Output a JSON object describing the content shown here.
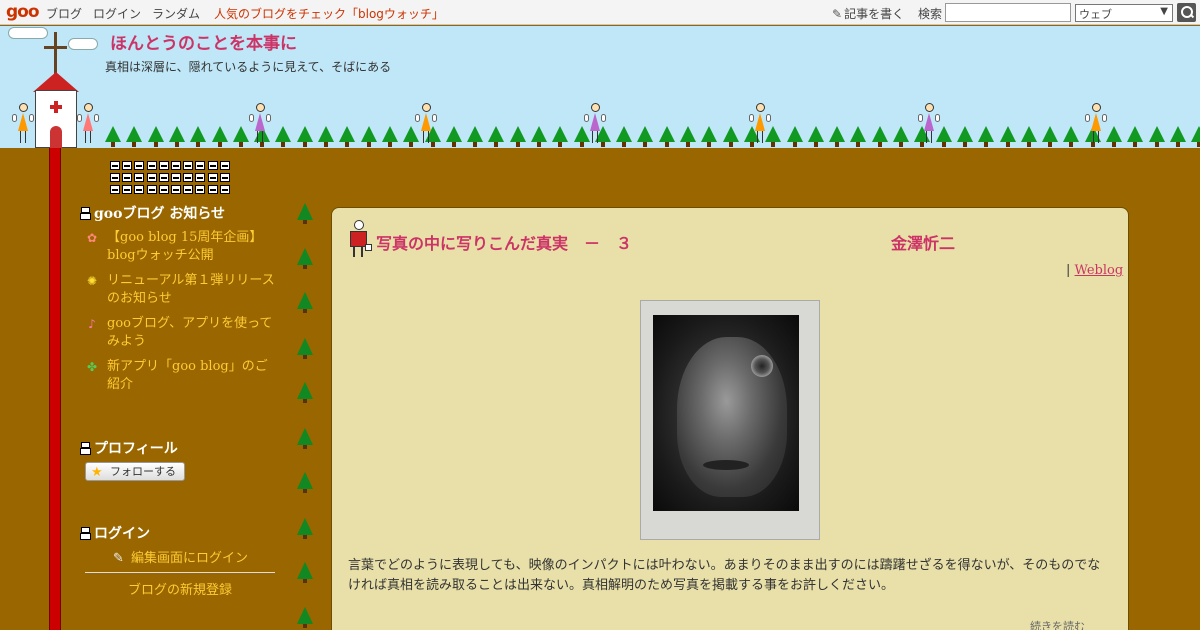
{
  "topbar": {
    "logo": "goo",
    "nav": [
      "ブログ",
      "ログイン",
      "ランダム"
    ],
    "pickup": "人気のブログをチェック「blogウォッチ」",
    "write": "記事を書く",
    "search_label": "検索",
    "search_value": "",
    "scope_selected": "ウェブ"
  },
  "header": {
    "title": "ほんとうのことを本事に",
    "description": "真相は深層に、隠れているように見えて、そばにある"
  },
  "sidebar": {
    "news_title": "gooブログ お知らせ",
    "news": [
      {
        "icon": "flower-icon",
        "text": "【goo blog 15周年企画】blogウォッチ公開"
      },
      {
        "icon": "bulb-icon",
        "text": "リニューアル第１弾リリースのお知らせ"
      },
      {
        "icon": "note-icon",
        "text": "gooブログ、アプリを使ってみよう"
      },
      {
        "icon": "clover-icon",
        "text": "新アプリ「goo blog」のご紹介"
      }
    ],
    "profile_title": "プロフィール",
    "follow_label": "フォローする",
    "login_title": "ログイン",
    "login_link": "編集画面にログイン",
    "register_link": "ブログの新規登録"
  },
  "article": {
    "title": "写真の中に写りこんだ真実　－　３",
    "author": "金澤忻二",
    "separator": "|",
    "category": "Weblog",
    "body": "言葉でどのように表現しても、映像のインパクトには叶わない。あまりそのまま出すのには躊躇せざるを得ないが、そのものでなければ真相を読み取ることは出来ない。真相解明のため写真を掲載する事をお許しください。",
    "footer": "続きを読む"
  },
  "colors": {
    "ground": "#996600",
    "sky": "#bfe7f7",
    "title": "#cc3366",
    "link": "#ffcc33",
    "card": "#e8e0a8",
    "pillar": "#cc0000"
  }
}
